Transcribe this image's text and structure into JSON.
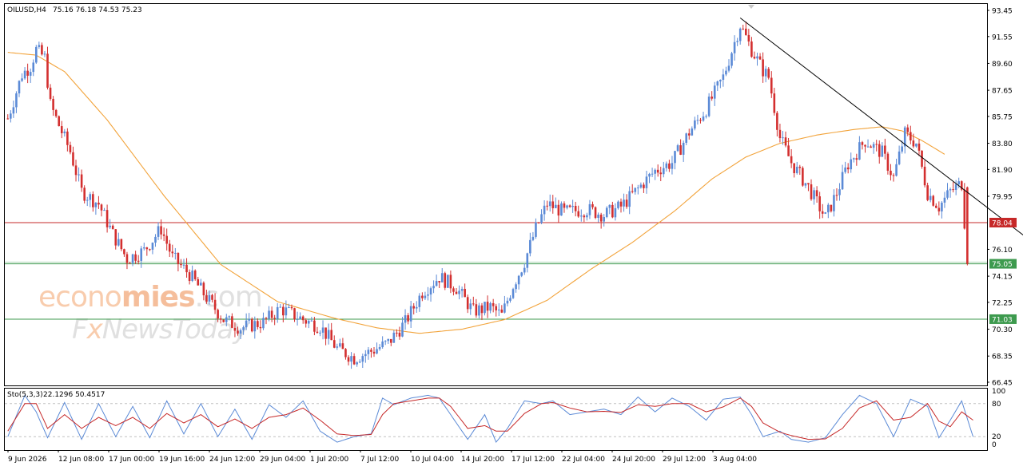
{
  "header": {
    "symbol_label": "OILUSD,H4",
    "ohlc_text": "75.16 76.18 74.53 75.23"
  },
  "indicator_header": {
    "label": "Sto(5,3,3)",
    "values_text": "22.1296 50.4517"
  },
  "watermark": {
    "line1_light": "econo",
    "line1_dark": "mies",
    "line1_tail": ".com",
    "line2_a": "F",
    "line2_x": "x",
    "line2_b": "NewsToday"
  },
  "colors": {
    "bull": "#5b8ad6",
    "bear": "#d32f2f",
    "ma": "#f2a33a",
    "resistance": "#c62828",
    "support": "#3d9a4e",
    "trendline": "#000000",
    "stoch_main": "#5b8ad6",
    "stoch_signal": "#c62828",
    "grid": "#c0c0c0"
  },
  "chart_data": [
    {
      "type": "candlestick",
      "title": "OILUSD,H4",
      "timeframe": "H4",
      "ylim": [
        66.45,
        93.45
      ],
      "y_ticks": [
        "93.45",
        "91.55",
        "89.60",
        "87.65",
        "85.75",
        "83.80",
        "81.90",
        "79.95",
        "78.04",
        "76.10",
        "75.05",
        "74.15",
        "72.25",
        "71.03",
        "70.30",
        "68.35",
        "66.45"
      ],
      "x_tick_labels": [
        "9 Jun 2026",
        "12 Jun 08:00",
        "17 Jun 00:00",
        "19 Jun 16:00",
        "24 Jun 12:00",
        "29 Jun 04:00",
        "1 Jul 20:00",
        "7 Jul 12:00",
        "10 Jul 04:00",
        "14 Jul 20:00",
        "17 Jul 12:00",
        "22 Jul 04:00",
        "24 Jul 20:00",
        "29 Jul 12:00",
        "3 Aug 04:00"
      ],
      "anchors": [
        [
          0,
          85.6
        ],
        [
          5,
          88.8
        ],
        [
          8,
          89.4
        ],
        [
          10,
          90.6
        ],
        [
          13,
          90.0
        ],
        [
          15,
          86.6
        ],
        [
          18,
          85.1
        ],
        [
          22,
          83.2
        ],
        [
          26,
          80.3
        ],
        [
          32,
          79.4
        ],
        [
          37,
          77.2
        ],
        [
          42,
          75.4
        ],
        [
          48,
          76.0
        ],
        [
          54,
          77.6
        ],
        [
          58,
          75.5
        ],
        [
          64,
          74.3
        ],
        [
          70,
          72.6
        ],
        [
          76,
          71.0
        ],
        [
          82,
          70.4
        ],
        [
          90,
          70.8
        ],
        [
          96,
          71.8
        ],
        [
          104,
          71.0
        ],
        [
          110,
          70.5
        ],
        [
          116,
          68.9
        ],
        [
          122,
          68.2
        ],
        [
          128,
          68.7
        ],
        [
          134,
          69.3
        ],
        [
          140,
          70.8
        ],
        [
          146,
          73.0
        ],
        [
          152,
          74.1
        ],
        [
          158,
          73.3
        ],
        [
          164,
          71.6
        ],
        [
          170,
          71.9
        ],
        [
          174,
          71.3
        ],
        [
          178,
          73.5
        ],
        [
          182,
          75.2
        ],
        [
          186,
          77.6
        ],
        [
          190,
          79.4
        ],
        [
          196,
          78.8
        ],
        [
          204,
          79.0
        ],
        [
          210,
          78.6
        ],
        [
          216,
          79.2
        ],
        [
          222,
          80.5
        ],
        [
          228,
          81.8
        ],
        [
          234,
          82.4
        ],
        [
          240,
          84.6
        ],
        [
          246,
          86.3
        ],
        [
          252,
          88.6
        ],
        [
          258,
          92.4
        ],
        [
          262,
          90.6
        ],
        [
          266,
          89.1
        ],
        [
          268,
          88.6
        ],
        [
          272,
          84.2
        ],
        [
          276,
          82.4
        ],
        [
          282,
          80.6
        ],
        [
          288,
          78.4
        ],
        [
          292,
          80.2
        ],
        [
          296,
          82.3
        ],
        [
          302,
          84.0
        ],
        [
          308,
          83.1
        ],
        [
          312,
          81.3
        ],
        [
          316,
          84.5
        ],
        [
          320,
          83.8
        ],
        [
          324,
          80.2
        ],
        [
          328,
          79.2
        ],
        [
          332,
          80.3
        ],
        [
          336,
          80.9
        ],
        [
          338,
          75.3
        ]
      ],
      "moving_average": [
        [
          0,
          90.4
        ],
        [
          10,
          90.2
        ],
        [
          20,
          89.0
        ],
        [
          35,
          85.5
        ],
        [
          55,
          80.0
        ],
        [
          75,
          75.0
        ],
        [
          95,
          72.3
        ],
        [
          115,
          71.1
        ],
        [
          130,
          70.4
        ],
        [
          145,
          70.0
        ],
        [
          160,
          70.3
        ],
        [
          175,
          71.0
        ],
        [
          190,
          72.4
        ],
        [
          205,
          74.6
        ],
        [
          220,
          76.6
        ],
        [
          235,
          78.9
        ],
        [
          248,
          81.2
        ],
        [
          260,
          82.8
        ],
        [
          272,
          83.8
        ],
        [
          285,
          84.4
        ],
        [
          298,
          84.8
        ],
        [
          308,
          85.0
        ],
        [
          315,
          84.7
        ],
        [
          322,
          84.0
        ],
        [
          330,
          83.0
        ]
      ],
      "horizontal_levels": [
        {
          "label": "78.04",
          "value": 78.04,
          "kind": "resistance"
        },
        {
          "label": "75.05",
          "value": 75.05,
          "kind": "support"
        },
        {
          "label": "71.03",
          "value": 71.03,
          "kind": "support"
        }
      ],
      "trendline": [
        [
          258,
          92.9
        ],
        [
          368,
          75.5
        ]
      ],
      "current_price": 75.05
    },
    {
      "type": "line",
      "title": "Sto(5,3,3)",
      "ylim": [
        0,
        100
      ],
      "y_ticks": [
        "100",
        "80",
        "20",
        "0"
      ],
      "levels": [
        80,
        20
      ],
      "series": [
        {
          "name": "main",
          "anchors": [
            [
              0,
              20
            ],
            [
              6,
              95
            ],
            [
              10,
              65
            ],
            [
              14,
              18
            ],
            [
              20,
              82
            ],
            [
              26,
              15
            ],
            [
              32,
              80
            ],
            [
              38,
              20
            ],
            [
              44,
              75
            ],
            [
              50,
              18
            ],
            [
              56,
              85
            ],
            [
              62,
              25
            ],
            [
              68,
              80
            ],
            [
              74,
              20
            ],
            [
              80,
              70
            ],
            [
              86,
              15
            ],
            [
              92,
              78
            ],
            [
              98,
              55
            ],
            [
              104,
              85
            ],
            [
              110,
              30
            ],
            [
              116,
              10
            ],
            [
              122,
              20
            ],
            [
              128,
              25
            ],
            [
              132,
              90
            ],
            [
              136,
              78
            ],
            [
              142,
              90
            ],
            [
              148,
              95
            ],
            [
              152,
              90
            ],
            [
              156,
              60
            ],
            [
              162,
              15
            ],
            [
              168,
              60
            ],
            [
              172,
              10
            ],
            [
              176,
              35
            ],
            [
              182,
              85
            ],
            [
              188,
              80
            ],
            [
              192,
              85
            ],
            [
              198,
              60
            ],
            [
              204,
              65
            ],
            [
              210,
              70
            ],
            [
              216,
              60
            ],
            [
              222,
              92
            ],
            [
              228,
              65
            ],
            [
              234,
              90
            ],
            [
              240,
              75
            ],
            [
              246,
              50
            ],
            [
              252,
              88
            ],
            [
              258,
              92
            ],
            [
              262,
              60
            ],
            [
              266,
              20
            ],
            [
              272,
              30
            ],
            [
              276,
              15
            ],
            [
              282,
              10
            ],
            [
              288,
              18
            ],
            [
              294,
              60
            ],
            [
              300,
              95
            ],
            [
              306,
              80
            ],
            [
              312,
              20
            ],
            [
              318,
              88
            ],
            [
              324,
              75
            ],
            [
              328,
              18
            ],
            [
              332,
              50
            ],
            [
              336,
              85
            ],
            [
              340,
              20
            ]
          ]
        },
        {
          "name": "signal",
          "anchors": [
            [
              0,
              30
            ],
            [
              6,
              80
            ],
            [
              10,
              80
            ],
            [
              14,
              35
            ],
            [
              20,
              60
            ],
            [
              26,
              35
            ],
            [
              32,
              55
            ],
            [
              38,
              40
            ],
            [
              44,
              55
            ],
            [
              50,
              35
            ],
            [
              56,
              62
            ],
            [
              62,
              45
            ],
            [
              68,
              60
            ],
            [
              74,
              38
            ],
            [
              80,
              52
            ],
            [
              86,
              35
            ],
            [
              92,
              55
            ],
            [
              98,
              60
            ],
            [
              104,
              72
            ],
            [
              110,
              50
            ],
            [
              116,
              25
            ],
            [
              122,
              22
            ],
            [
              128,
              24
            ],
            [
              132,
              60
            ],
            [
              136,
              80
            ],
            [
              142,
              85
            ],
            [
              148,
              90
            ],
            [
              152,
              90
            ],
            [
              156,
              75
            ],
            [
              162,
              35
            ],
            [
              168,
              40
            ],
            [
              172,
              30
            ],
            [
              176,
              30
            ],
            [
              182,
              62
            ],
            [
              188,
              80
            ],
            [
              192,
              82
            ],
            [
              198,
              72
            ],
            [
              204,
              65
            ],
            [
              210,
              66
            ],
            [
              216,
              64
            ],
            [
              222,
              78
            ],
            [
              228,
              75
            ],
            [
              234,
              80
            ],
            [
              240,
              80
            ],
            [
              246,
              65
            ],
            [
              252,
              74
            ],
            [
              258,
              90
            ],
            [
              262,
              75
            ],
            [
              266,
              45
            ],
            [
              272,
              28
            ],
            [
              276,
              22
            ],
            [
              282,
              15
            ],
            [
              288,
              16
            ],
            [
              294,
              35
            ],
            [
              300,
              72
            ],
            [
              306,
              85
            ],
            [
              312,
              50
            ],
            [
              318,
              55
            ],
            [
              324,
              80
            ],
            [
              328,
              48
            ],
            [
              332,
              38
            ],
            [
              336,
              65
            ],
            [
              340,
              50
            ]
          ]
        }
      ],
      "last_values": [
        22.1296,
        50.4517
      ]
    }
  ]
}
